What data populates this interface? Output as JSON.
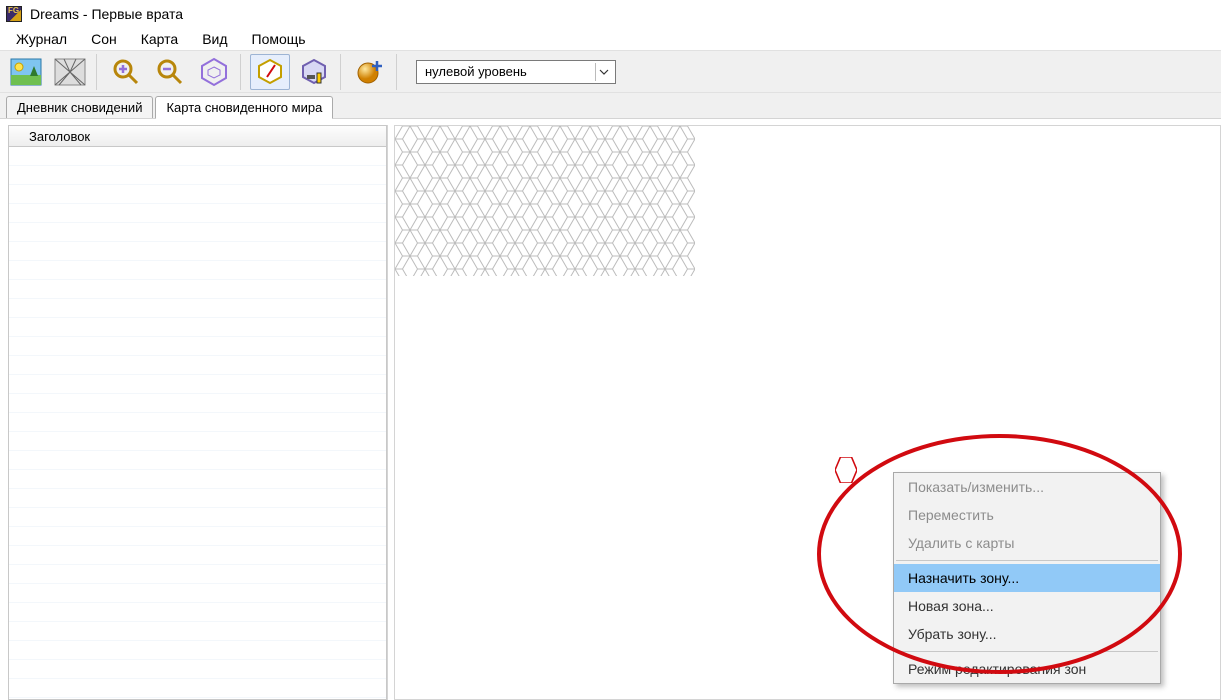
{
  "window": {
    "title": "Dreams - Первые врата"
  },
  "menu": {
    "items": [
      "Журнал",
      "Сон",
      "Карта",
      "Вид",
      "Помощь"
    ]
  },
  "toolbar": {
    "landscape_btn": "landscape",
    "shard_btn": "shard",
    "zoom_in_btn": "zoom-in",
    "zoom_out_btn": "zoom-out",
    "hex_purple_btn": "hex-purple",
    "hex_edit_btn": "hex-edit",
    "hex_tools_btn": "hex-tools",
    "sphere_add_btn": "sphere-add"
  },
  "level_select": {
    "value": "нулевой уровень"
  },
  "tabs": {
    "items": [
      {
        "label": "Дневник сновидений",
        "active": false
      },
      {
        "label": "Карта сновиденного мира",
        "active": true
      }
    ]
  },
  "side_panel": {
    "header": "Заголовок"
  },
  "context_menu": {
    "items": [
      {
        "label": "Показать/изменить...",
        "state": "disabled"
      },
      {
        "label": "Переместить",
        "state": "disabled"
      },
      {
        "label": "Удалить с карты",
        "state": "disabled"
      },
      {
        "type": "sep"
      },
      {
        "label": "Назначить зону...",
        "state": "selected"
      },
      {
        "label": "Новая зона...",
        "state": "normal"
      },
      {
        "label": "Убрать зону...",
        "state": "normal"
      },
      {
        "type": "sep"
      },
      {
        "label": "Режим редактирования зон",
        "state": "normal"
      }
    ]
  }
}
